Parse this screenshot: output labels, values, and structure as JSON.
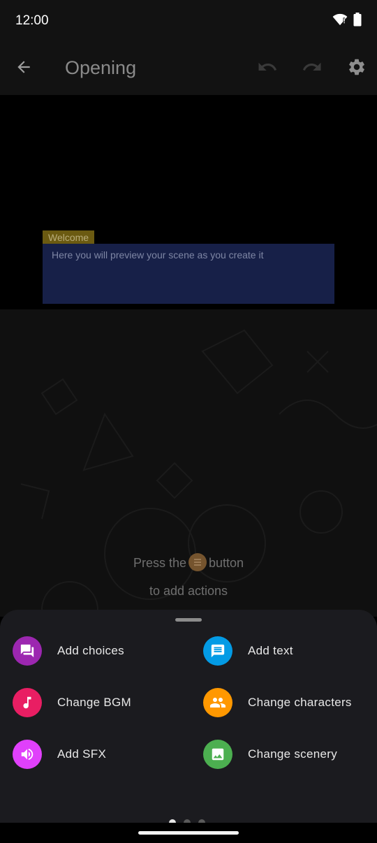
{
  "status_bar": {
    "time": "12:00",
    "icons": [
      "wifi-icon",
      "battery-icon"
    ]
  },
  "app_bar": {
    "title": "Opening",
    "icons": {
      "back": "arrow-back-icon",
      "undo": "undo-icon",
      "redo": "redo-icon",
      "settings": "gear-icon"
    }
  },
  "preview": {
    "speaker": "Welcome",
    "dialog": "Here you will preview your scene as you create it"
  },
  "hint": {
    "before": "Press the",
    "after": "button",
    "line2": "to add actions",
    "icon": "menu-icon"
  },
  "actions": [
    {
      "label": "Add choices",
      "icon": "forum-icon",
      "color": "#9c27b0"
    },
    {
      "label": "Add text",
      "icon": "message-icon",
      "color": "#039be5"
    },
    {
      "label": "Change BGM",
      "icon": "music-note-icon",
      "color": "#e91e63"
    },
    {
      "label": "Change characters",
      "icon": "people-icon",
      "color": "#ff9800"
    },
    {
      "label": "Add SFX",
      "icon": "volume-icon",
      "color": "#e040fb"
    },
    {
      "label": "Change scenery",
      "icon": "image-icon",
      "color": "#4caf50"
    }
  ],
  "pagination": {
    "pages": 3,
    "current": 1
  },
  "colors": {
    "surface": "#121212",
    "sheet": "#1b1b1f",
    "dialog_box": "#172048",
    "speaker_tag": "#6b5a11"
  }
}
